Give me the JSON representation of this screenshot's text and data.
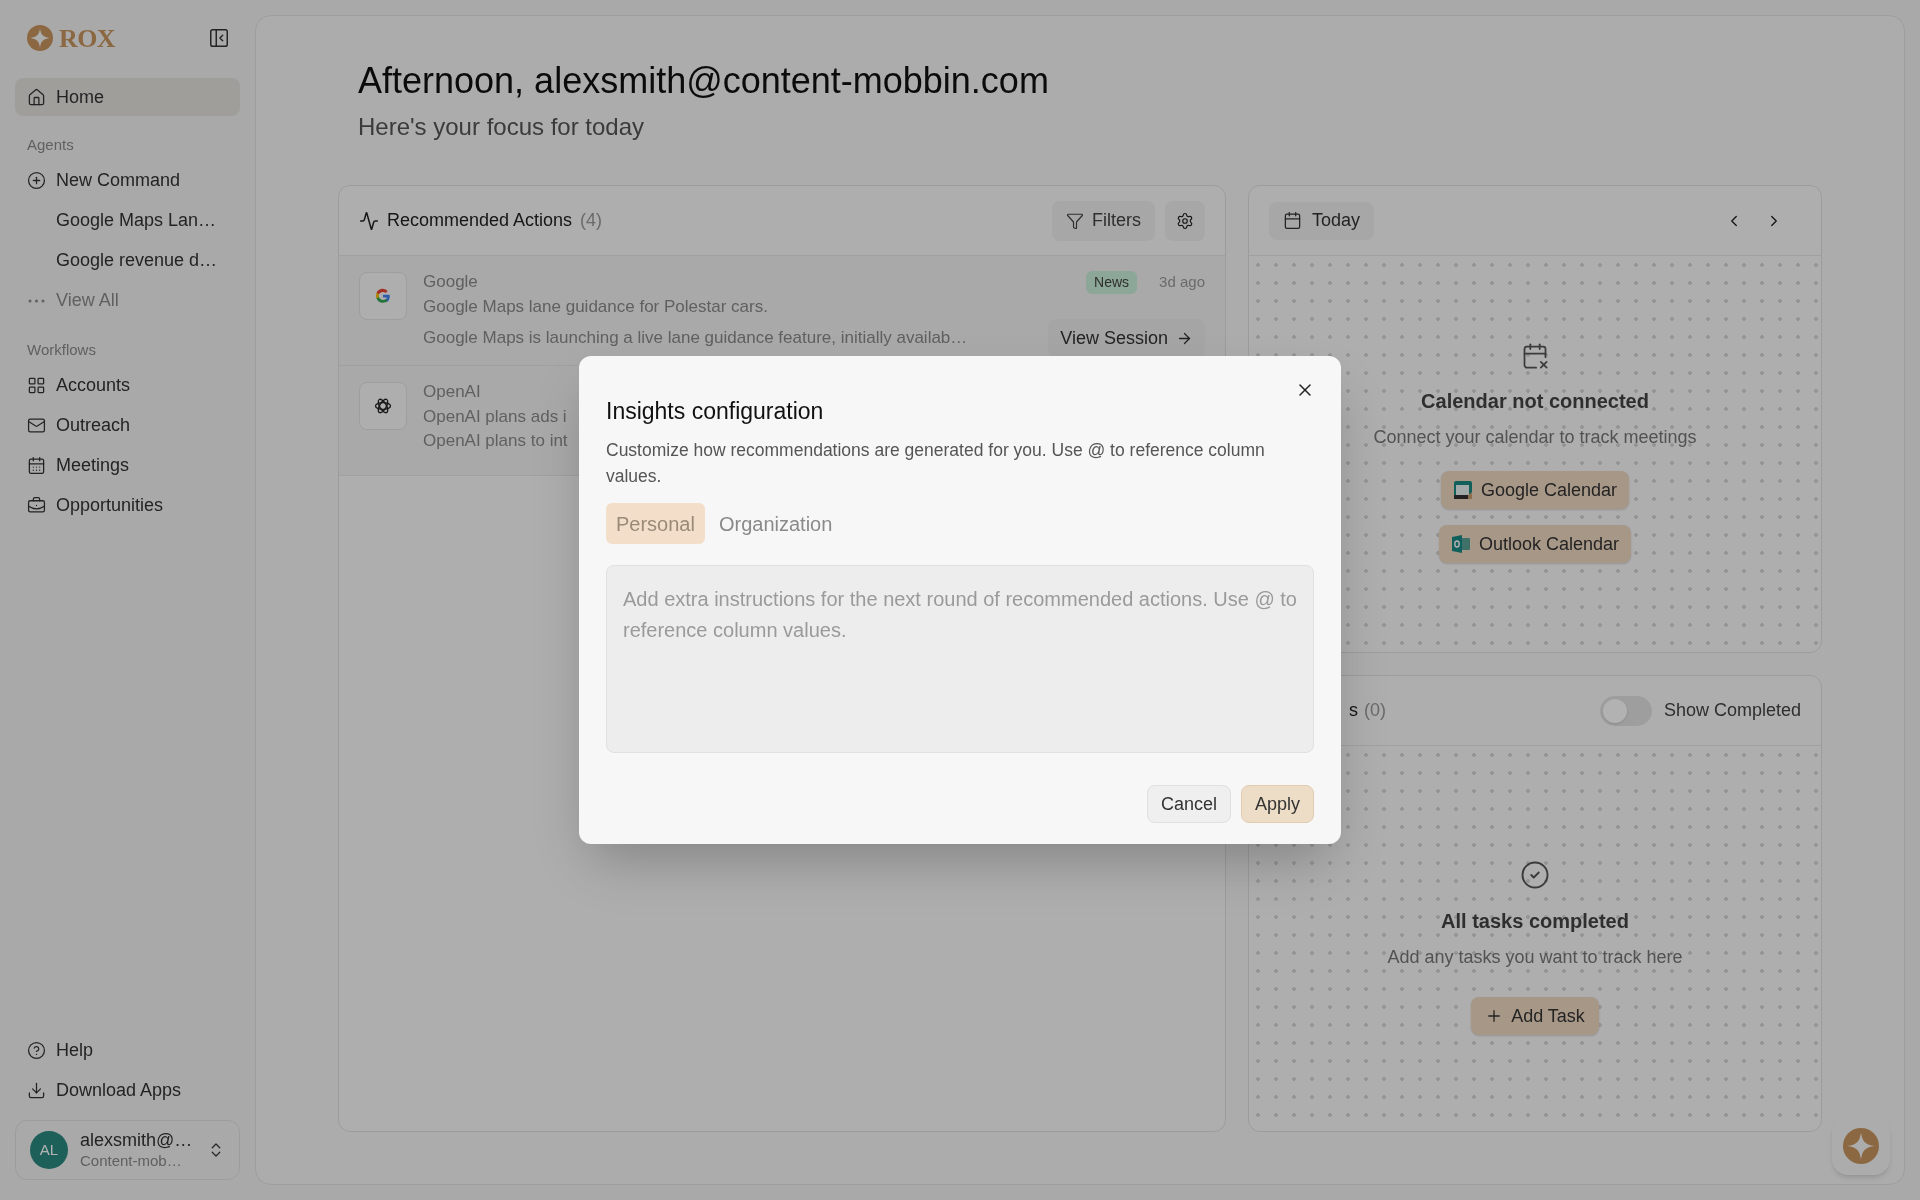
{
  "sidebar": {
    "logo": "ROX",
    "nav": [
      {
        "label": "Home",
        "selected": true
      }
    ],
    "sections": [
      {
        "title": "Agents",
        "items": [
          {
            "kind": "new",
            "label": "New Command"
          },
          {
            "kind": "session",
            "label": "Google Maps Lan…"
          },
          {
            "kind": "session",
            "label": "Google revenue d…"
          },
          {
            "kind": "more",
            "label": "View All"
          }
        ]
      },
      {
        "title": "Workflows",
        "items": [
          {
            "kind": "accounts",
            "label": "Accounts"
          },
          {
            "kind": "outreach",
            "label": "Outreach"
          },
          {
            "kind": "meetings",
            "label": "Meetings"
          },
          {
            "kind": "opportunities",
            "label": "Opportunities"
          }
        ]
      }
    ],
    "footer": [
      {
        "kind": "help",
        "label": "Help"
      },
      {
        "kind": "download",
        "label": "Download Apps"
      }
    ],
    "user": {
      "initials": "AL",
      "name": "alexsmith@…",
      "org": "Content-mob…"
    }
  },
  "greeting": {
    "title": "Afternoon, alexsmith@content-mobbin.com",
    "subtitle": "Here's your focus for today"
  },
  "recommended": {
    "title": "Recommended Actions",
    "count": "(4)",
    "filters": "Filters",
    "rows": [
      {
        "kind": "google",
        "company": "Google",
        "headline": "Google Maps lane guidance for Polestar cars.",
        "summary": "Google Maps is launching a live lane guidance feature, initially availab…",
        "tag": "News",
        "time": "3d ago",
        "action": "View Session"
      },
      {
        "kind": "openai",
        "company": "OpenAI",
        "headline": "OpenAI plans ads i",
        "summary": "OpenAI plans to int"
      }
    ]
  },
  "calendar": {
    "today": "Today",
    "empty_title": "Calendar not connected",
    "empty_text": "Connect your calendar to track meetings",
    "buttons": [
      {
        "kind": "google",
        "label": "Google Calendar"
      },
      {
        "kind": "outlook",
        "label": "Outlook Calendar"
      }
    ]
  },
  "tasks": {
    "title": "s",
    "count": "(0)",
    "toggle": {
      "label": "Show Completed",
      "on": false
    },
    "empty_title": "All tasks completed",
    "empty_text": "Add any tasks you want to track here",
    "add": "Add Task"
  },
  "dialog": {
    "title": "Insights configuration",
    "description": "Customize how recommendations are generated for you. Use @ to reference column values.",
    "tabs": [
      {
        "label": "Personal",
        "selected": true
      },
      {
        "label": "Organization",
        "selected": false
      }
    ],
    "placeholder": "Add extra instructions for the next round of recommended actions. Use @ to reference column values.",
    "buttons": [
      {
        "kind": "secondary",
        "label": "Cancel"
      },
      {
        "kind": "primary",
        "label": "Apply"
      }
    ]
  }
}
